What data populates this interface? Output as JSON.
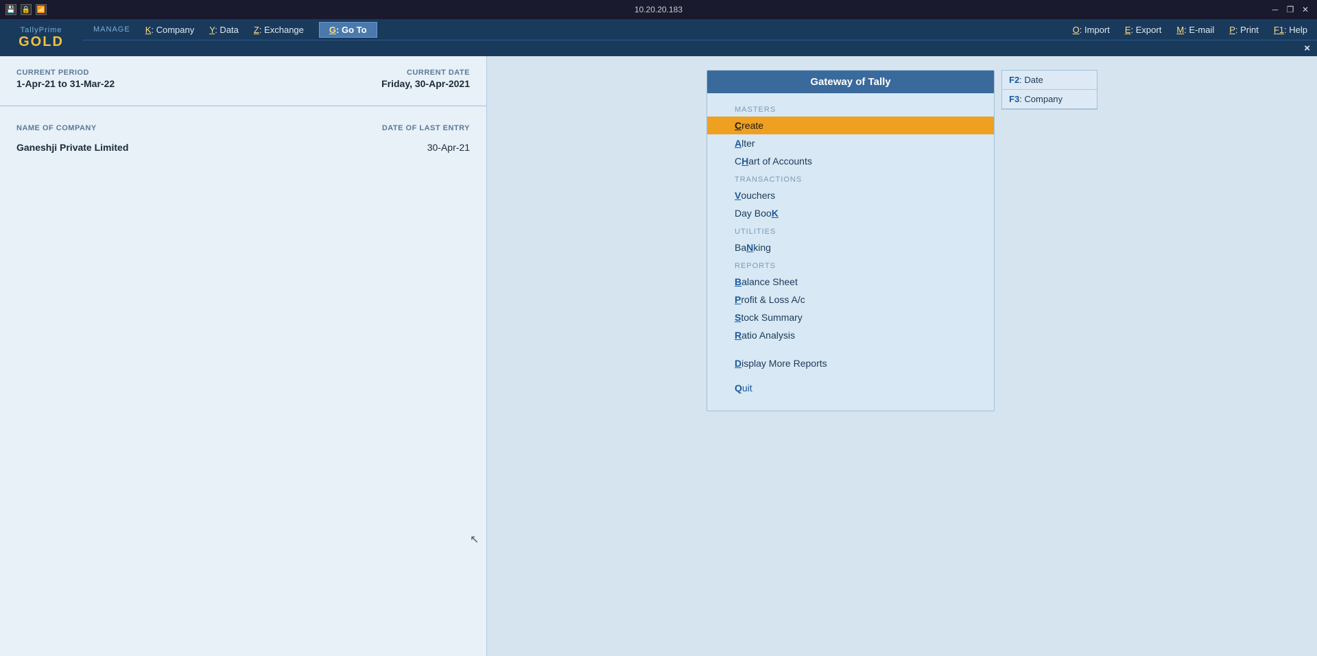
{
  "titlebar": {
    "ip": "10.20.20.183",
    "icons": [
      "save-icon",
      "lock-icon",
      "signal-icon"
    ],
    "controls": [
      "minimize",
      "restore",
      "close"
    ]
  },
  "applogo": {
    "top": "TallyPrime",
    "bottom": "GOLD",
    "sub": ""
  },
  "menubar": {
    "items": [
      {
        "key": "K",
        "label": "Company"
      },
      {
        "key": "Y",
        "label": "Data"
      },
      {
        "key": "Z",
        "label": "Exchange"
      },
      {
        "key": "G",
        "label": "Go To",
        "goto": true
      },
      {
        "key": "O",
        "label": "Import"
      },
      {
        "key": "E",
        "label": "Export"
      },
      {
        "key": "M",
        "label": "E-mail"
      },
      {
        "key": "P",
        "label": "Print"
      },
      {
        "key": "F1",
        "label": "Help"
      }
    ]
  },
  "subbar": {
    "title": "Gateway of Tally",
    "close": "×"
  },
  "leftpanel": {
    "current_period_label": "CURRENT PERIOD",
    "current_period_value": "1-Apr-21 to 31-Mar-22",
    "current_date_label": "CURRENT DATE",
    "current_date_value": "Friday, 30-Apr-2021",
    "name_of_company_label": "NAME OF COMPANY",
    "date_of_last_entry_label": "DATE OF LAST ENTRY",
    "company_name": "Ganeshji Private Limited",
    "last_entry_date": "30-Apr-21"
  },
  "gateway": {
    "title": "Gateway of Tally",
    "sections": [
      {
        "name": "MASTERS",
        "items": [
          {
            "label": "Create",
            "highlight_char": "C",
            "active": true
          },
          {
            "label": "Alter",
            "highlight_char": "A",
            "active": false
          },
          {
            "label": "CHart of Accounts",
            "highlight_char": "H",
            "active": false
          }
        ]
      },
      {
        "name": "TRANSACTIONS",
        "items": [
          {
            "label": "Vouchers",
            "highlight_char": "V",
            "active": false
          },
          {
            "label": "Day BooK",
            "highlight_char": "K",
            "active": false
          }
        ]
      },
      {
        "name": "UTILITIES",
        "items": [
          {
            "label": "BaNking",
            "highlight_char": "N",
            "active": false
          }
        ]
      },
      {
        "name": "REPORTS",
        "items": [
          {
            "label": "Balance Sheet",
            "highlight_char": "B",
            "active": false
          },
          {
            "label": "Profit & Loss A/c",
            "highlight_char": "P",
            "active": false
          },
          {
            "label": "Stock Summary",
            "highlight_char": "S",
            "active": false
          },
          {
            "label": "Ratio Analysis",
            "highlight_char": "R",
            "active": false
          }
        ]
      }
    ],
    "extra_items": [
      {
        "label": "Display More Reports",
        "highlight_char": "D"
      }
    ],
    "quit": {
      "label": "Quit",
      "highlight_char": "Q"
    }
  },
  "fkeys": [
    {
      "key": "F2",
      "label": "Date"
    },
    {
      "key": "F3",
      "label": "Company"
    }
  ],
  "manage_label": "MANAGE"
}
